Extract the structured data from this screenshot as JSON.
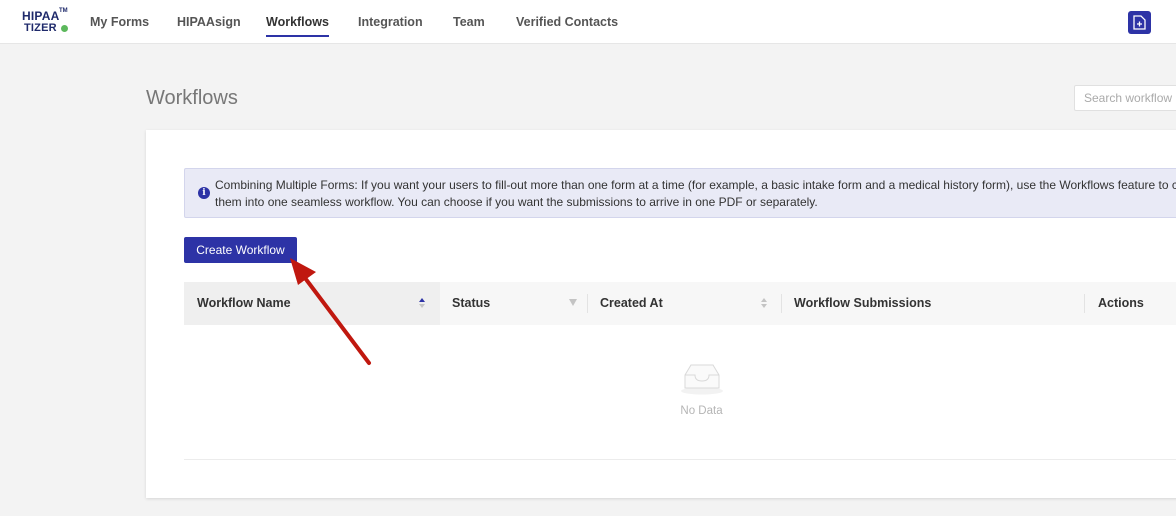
{
  "logo": {
    "line1": "HIPAA",
    "tm": "TM",
    "line2": "TIZER"
  },
  "nav": {
    "items": [
      {
        "label": "My Forms"
      },
      {
        "label": "HIPAAsign"
      },
      {
        "label": "Workflows",
        "active": true
      },
      {
        "label": "Integration"
      },
      {
        "label": "Team"
      },
      {
        "label": "Verified Contacts"
      }
    ],
    "doc_icon": "document-icon"
  },
  "page": {
    "title": "Workflows",
    "search_placeholder": "Search workflow"
  },
  "info": {
    "icon": "info-icon",
    "line1": "Combining Multiple Forms: If you want your users to fill-out more than one form at a time (for example, a basic intake form and a medical history form), use the Workflows feature to co",
    "line2": "them into one seamless workflow. You can choose if you want the submissions to arrive in one PDF or separately."
  },
  "create_button": {
    "label": "Create Workflow"
  },
  "table": {
    "columns": [
      "Workflow Name",
      "Status",
      "Created At",
      "Workflow Submissions",
      "Actions"
    ],
    "empty_text": "No Data"
  },
  "colors": {
    "accent": "#2d33a6",
    "annotation_arrow": "#c0180f"
  }
}
